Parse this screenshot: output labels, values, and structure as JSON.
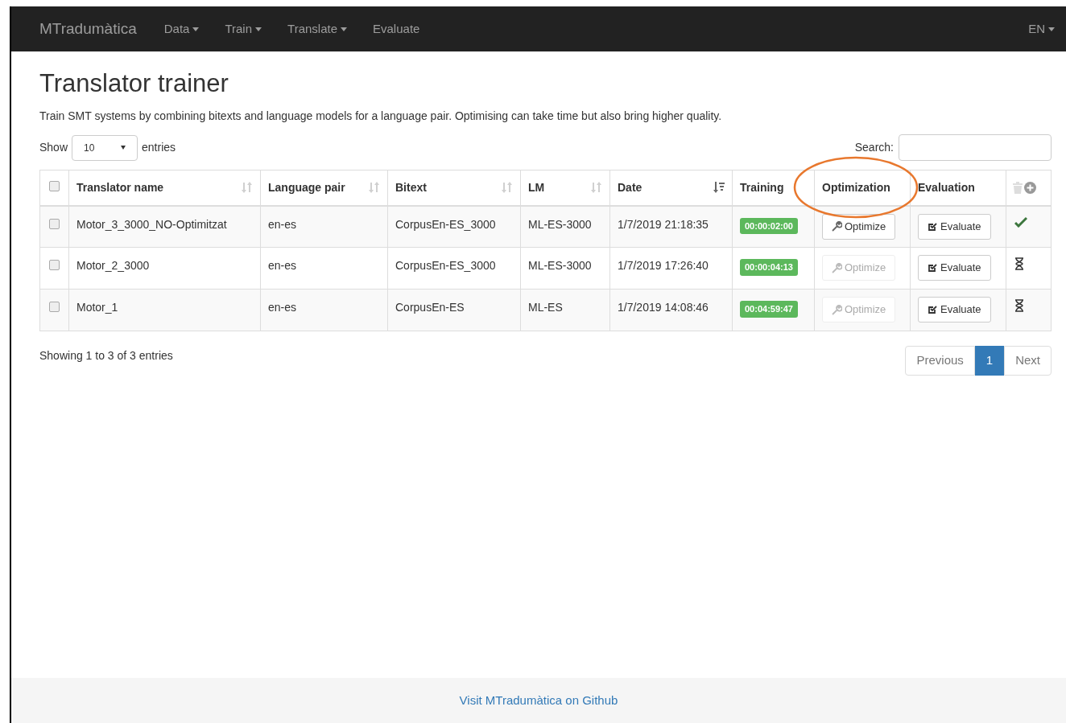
{
  "navbar": {
    "brand": "MTradumàtica",
    "items": [
      {
        "label": "Data",
        "dropdown": true
      },
      {
        "label": "Train",
        "dropdown": true
      },
      {
        "label": "Translate",
        "dropdown": true
      },
      {
        "label": "Evaluate",
        "dropdown": false
      }
    ],
    "language": "EN"
  },
  "page": {
    "title": "Translator trainer",
    "description": "Train SMT systems by combining bitexts and language models for a language pair. Optimising can take time but also bring higher quality."
  },
  "length_control": {
    "before": "Show",
    "value": "10",
    "after": "entries"
  },
  "search": {
    "label": "Search:"
  },
  "table": {
    "select_all_checked": false,
    "columns": [
      {
        "label": "Translator name",
        "sortable": true,
        "sorted_desc": false,
        "highlighted": false
      },
      {
        "label": "Language pair",
        "sortable": true,
        "sorted_desc": false,
        "highlighted": false
      },
      {
        "label": "Bitext",
        "sortable": true,
        "sorted_desc": false,
        "highlighted": false
      },
      {
        "label": "LM",
        "sortable": true,
        "sorted_desc": false,
        "highlighted": false
      },
      {
        "label": "Date",
        "sortable": true,
        "sorted_desc": true,
        "highlighted": false
      },
      {
        "label": "Training",
        "sortable": false,
        "highlighted": false
      },
      {
        "label": "Optimization",
        "sortable": false,
        "highlighted": true
      },
      {
        "label": "Evaluation",
        "sortable": false,
        "highlighted": false
      }
    ],
    "rows": [
      {
        "checked": false,
        "name": "Motor_3_3000_NO-Optimitzat",
        "language_pair": "en-es",
        "bitext": "CorpusEn-ES_3000",
        "lm": "ML-ES-3000",
        "date": "1/7/2019 21:18:35",
        "training": "00:00:02:00",
        "optimize": {
          "label": "Optimize",
          "disabled": false
        },
        "evaluate": "Evaluate",
        "finished": true
      },
      {
        "checked": false,
        "name": "Motor_2_3000",
        "language_pair": "en-es",
        "bitext": "CorpusEn-ES_3000",
        "lm": "ML-ES-3000",
        "date": "1/7/2019 17:26:40",
        "training": "00:00:04:13",
        "optimize": {
          "label": "Optimize",
          "disabled": true
        },
        "evaluate": "Evaluate",
        "finished": false
      },
      {
        "checked": false,
        "name": "Motor_1",
        "language_pair": "en-es",
        "bitext": "CorpusEn-ES",
        "lm": "ML-ES",
        "date": "1/7/2019 14:08:46",
        "training": "00:04:59:47",
        "optimize": {
          "label": "Optimize",
          "disabled": true
        },
        "evaluate": "Evaluate",
        "finished": false
      }
    ]
  },
  "info": "Showing 1 to 3 of 3 entries",
  "pagination": [
    {
      "label": "Previous",
      "selected": false
    },
    {
      "label": "1",
      "selected": true
    },
    {
      "label": "Next",
      "selected": false
    }
  ],
  "footer": {
    "link": "Visit MTradumàtica on Github"
  }
}
